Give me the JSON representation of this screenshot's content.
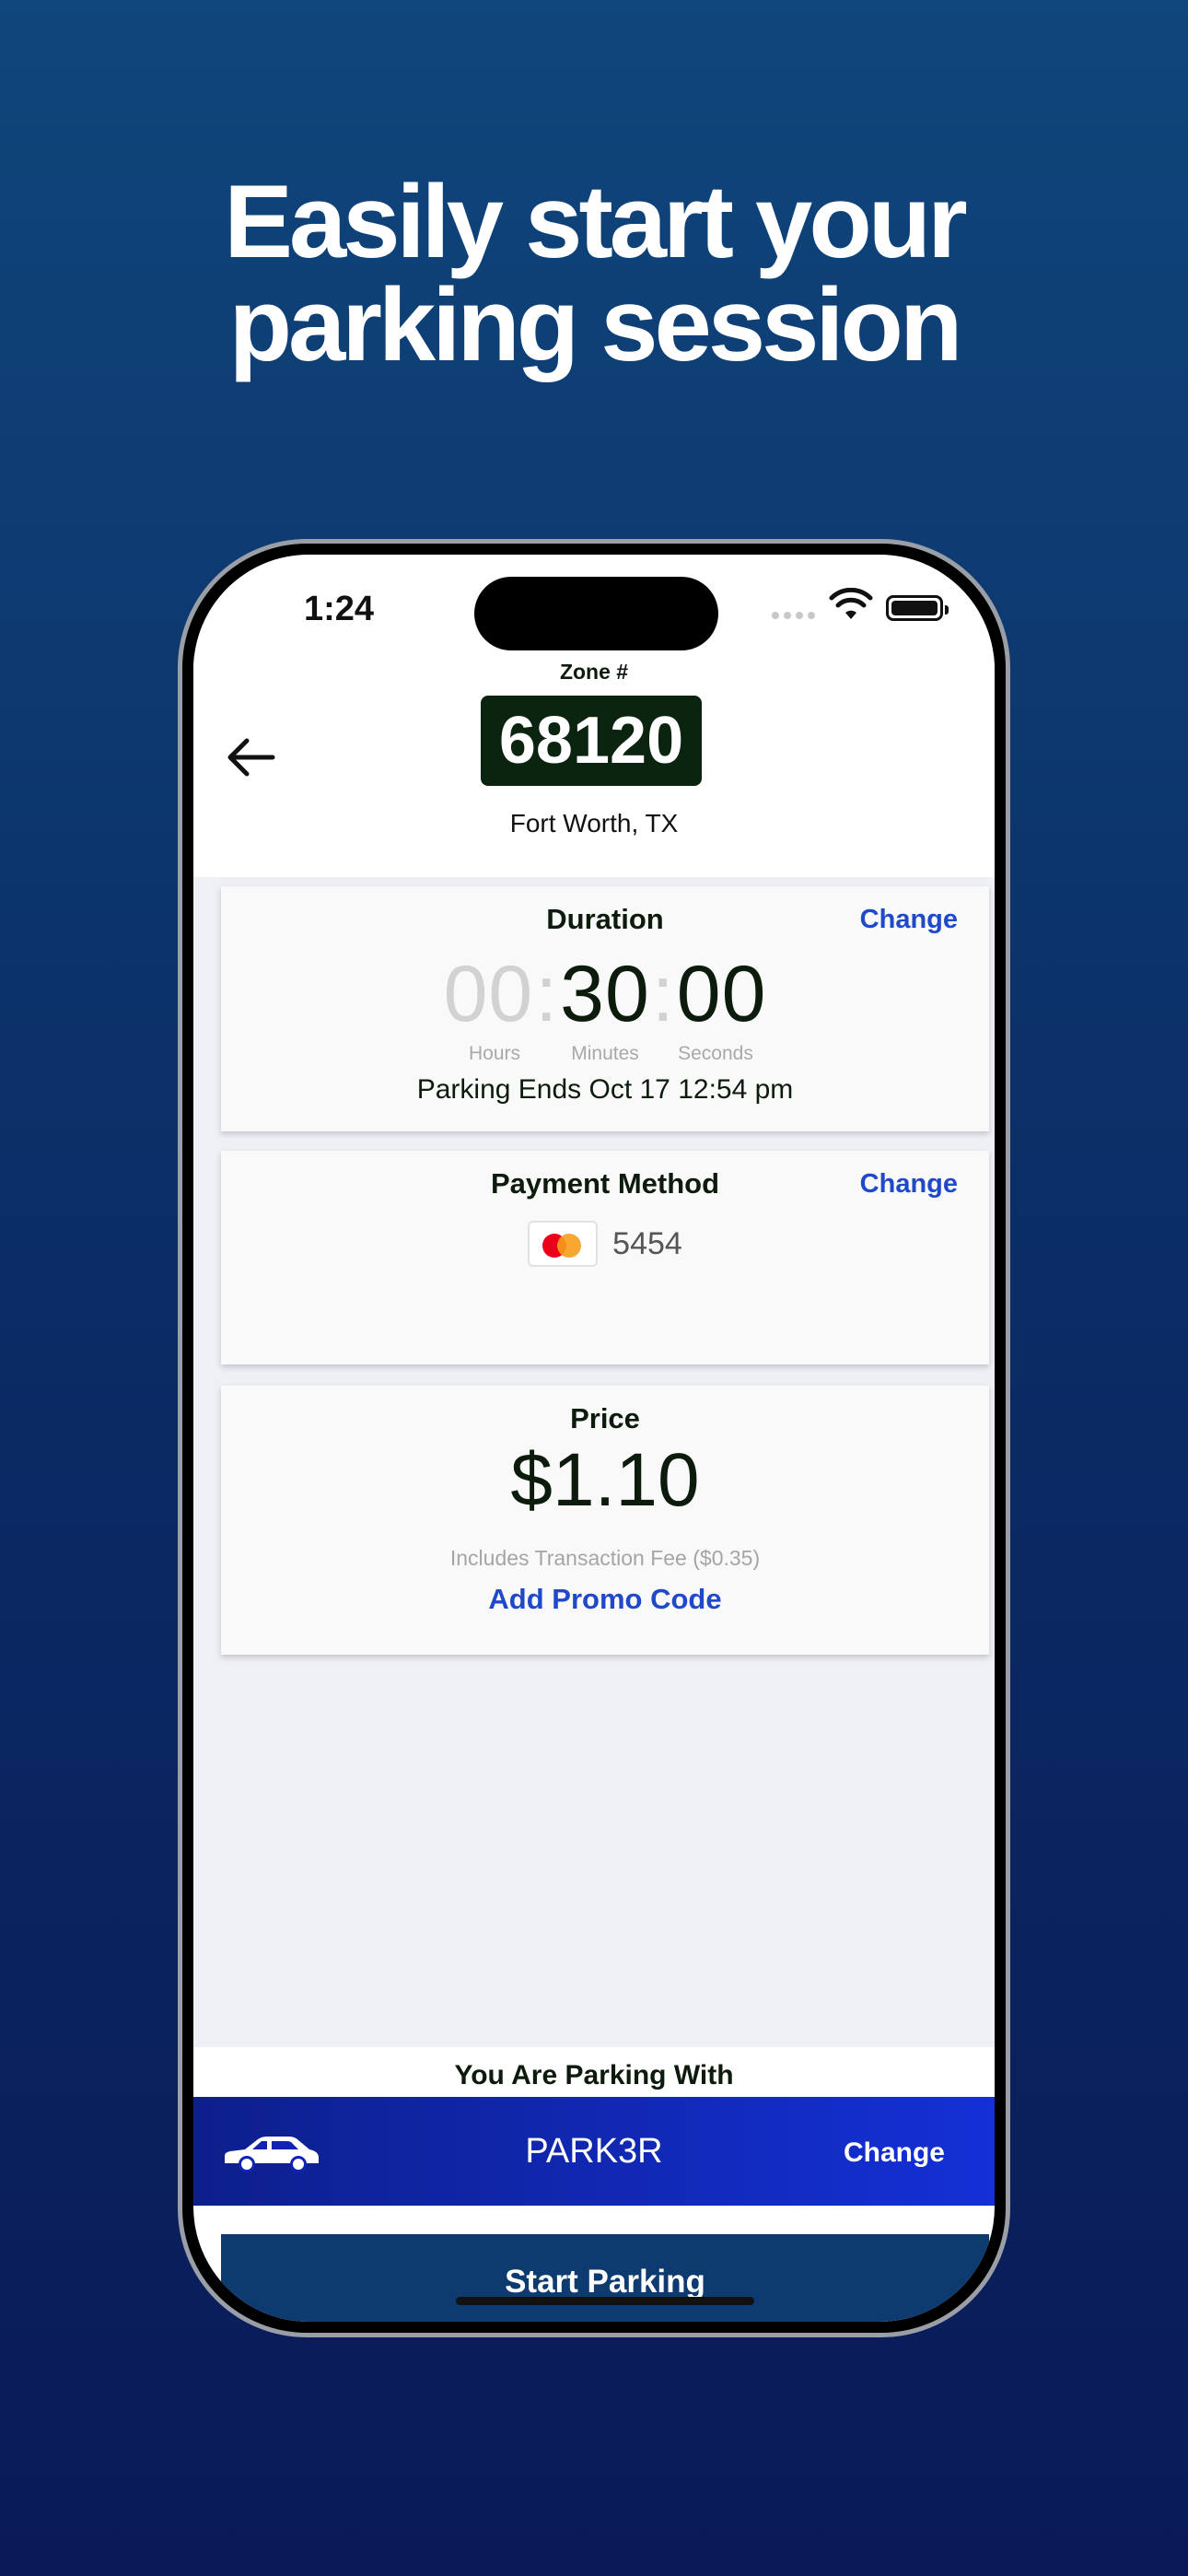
{
  "promo_headline": {
    "line1": "Easily start your",
    "line2": "parking session"
  },
  "status_bar": {
    "time": "1:24"
  },
  "zone": {
    "label": "Zone #",
    "number": "68120",
    "city": "Fort Worth, TX"
  },
  "duration": {
    "title": "Duration",
    "change_label": "Change",
    "hours": "00",
    "minutes": "30",
    "seconds": "00",
    "hours_label": "Hours",
    "minutes_label": "Minutes",
    "seconds_label": "Seconds",
    "ends_text": "Parking Ends Oct 17 12:54 pm"
  },
  "payment": {
    "title": "Payment Method",
    "change_label": "Change",
    "card_brand_icon": "mastercard-icon",
    "card_last4": "5454"
  },
  "price": {
    "title": "Price",
    "amount": "$1.10",
    "fee_note": "Includes Transaction Fee ($0.35)",
    "promo_label": "Add Promo Code"
  },
  "vehicle": {
    "heading": "You Are Parking With",
    "plate": "PARK3R",
    "change_label": "Change",
    "icon": "car-icon"
  },
  "actions": {
    "start_label": "Start Parking"
  },
  "colors": {
    "accent_blue": "#1f49c8",
    "zone_plate_bg": "#0b2410",
    "start_button_bg": "#0e3b6f",
    "vehicle_bar_bg": "#1430d6"
  }
}
